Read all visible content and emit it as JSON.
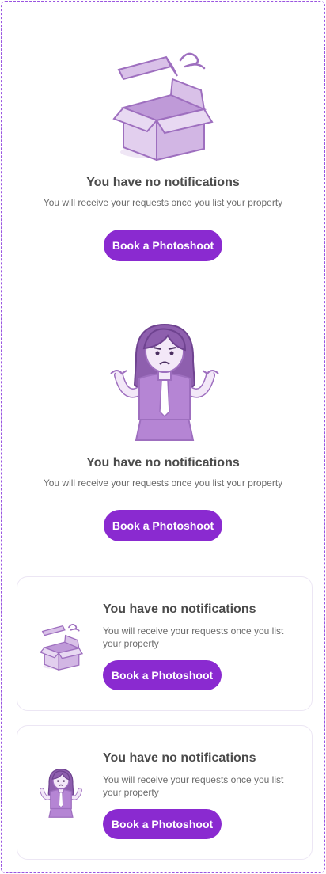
{
  "states": [
    {
      "title": "You have no notifications",
      "subtitle": "You will receive your requests once you list your property",
      "button_label": "Book a Photoshoot"
    },
    {
      "title": "You have no notifications",
      "subtitle": "You will receive your requests once you list your property",
      "button_label": "Book a Photoshoot"
    },
    {
      "title": "You have no notifications",
      "subtitle": "You will receive your requests once you list your property",
      "button_label": "Book a Photoshoot"
    },
    {
      "title": "You have no notifications",
      "subtitle": "You will receive your requests once you list your property",
      "button_label": "Book a Photoshoot"
    }
  ],
  "colors": {
    "accent": "#8a2ad0",
    "frame_border": "#9a55e0",
    "illustration_fill": "#d9c1e8",
    "illustration_stroke": "#9e6fbf"
  },
  "icons": [
    "empty-box-icon",
    "confused-woman-icon"
  ]
}
